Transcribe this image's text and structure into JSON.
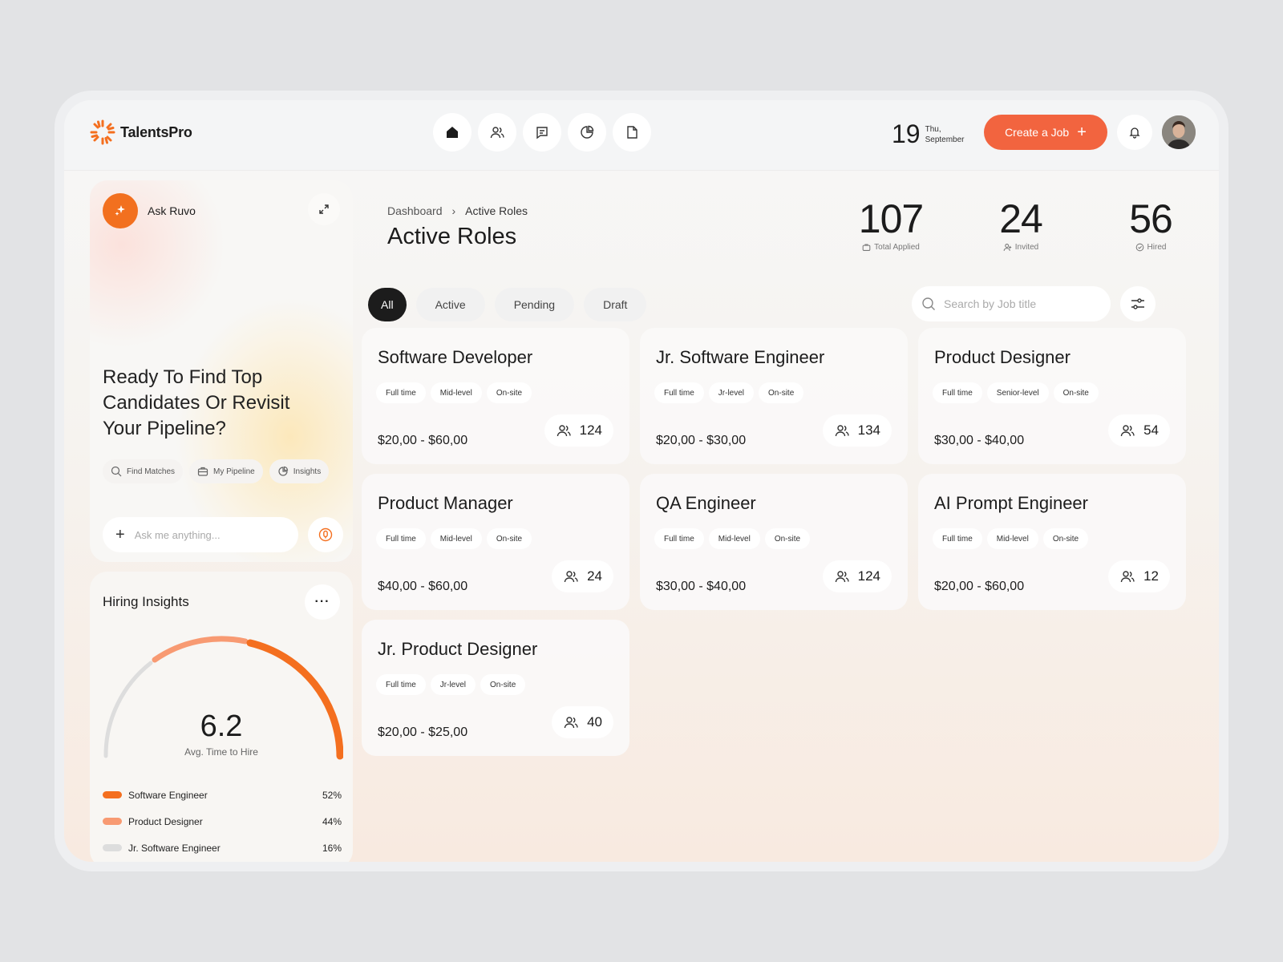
{
  "app": {
    "name": "TalentsPro"
  },
  "nav": [
    "home-icon",
    "users-icon",
    "message-icon",
    "pie-chart-icon",
    "document-icon"
  ],
  "date": {
    "day": "19",
    "weekday": "Thu,",
    "month": "September"
  },
  "header": {
    "create_label": "Create a Job"
  },
  "ruvo": {
    "name": "Ask Ruvo",
    "headline": "Ready To Find Top Candidates Or Revisit Your Pipeline?",
    "chips": [
      {
        "label": "Find Matches",
        "icon": "search-icon"
      },
      {
        "label": "My Pipeline",
        "icon": "briefcase-icon"
      },
      {
        "label": "Insights",
        "icon": "pie-chart-icon"
      }
    ],
    "input_placeholder": "Ask me anything..."
  },
  "insights": {
    "title": "Hiring Insights",
    "value": "6.2",
    "label": "Avg. Time to Hire",
    "items": [
      {
        "name": "Software Engineer",
        "pct": "52%",
        "color": "#f46f1f"
      },
      {
        "name": "Product Designer",
        "pct": "44%",
        "color": "#f89a72"
      },
      {
        "name": "Jr. Software Engineer",
        "pct": "16%",
        "color": "#dddddd"
      }
    ]
  },
  "breadcrumb": {
    "root": "Dashboard",
    "current": "Active Roles"
  },
  "page": {
    "title": "Active Roles"
  },
  "stats": [
    {
      "value": "107",
      "label": "Total Applied",
      "icon": "briefcase-icon"
    },
    {
      "value": "24",
      "label": "Invited",
      "icon": "user-add-icon"
    },
    {
      "value": "56",
      "label": "Hired",
      "icon": "check-circle-icon"
    }
  ],
  "filters": [
    "All",
    "Active",
    "Pending",
    "Draft"
  ],
  "search": {
    "placeholder": "Search by Job title"
  },
  "jobs": [
    {
      "title": "Software Developer",
      "tags": [
        "Full time",
        "Mid-level",
        "On-site"
      ],
      "salary": "$20,00 - $60,00",
      "count": "124"
    },
    {
      "title": "Jr. Software Engineer",
      "tags": [
        "Full time",
        "Jr-level",
        "On-site"
      ],
      "salary": "$20,00 - $30,00",
      "count": "134"
    },
    {
      "title": "Product Designer",
      "tags": [
        "Full time",
        "Senior-level",
        "On-site"
      ],
      "salary": "$30,00 - $40,00",
      "count": "54"
    },
    {
      "title": "Product Manager",
      "tags": [
        "Full time",
        "Mid-level",
        "On-site"
      ],
      "salary": "$40,00 - $60,00",
      "count": "24"
    },
    {
      "title": "QA Engineer",
      "tags": [
        "Full time",
        "Mid-level",
        "On-site"
      ],
      "salary": "$30,00 - $40,00",
      "count": "124"
    },
    {
      "title": "AI Prompt Engineer",
      "tags": [
        "Full time",
        "Mid-level",
        "On-site"
      ],
      "salary": "$20,00 - $60,00",
      "count": "12"
    },
    {
      "title": "Jr. Product Designer",
      "tags": [
        "Full time",
        "Jr-level",
        "On-site"
      ],
      "salary": "$20,00 - $25,00",
      "count": "40"
    }
  ],
  "colors": {
    "accent": "#f2643f",
    "orange": "#f46f1f"
  }
}
